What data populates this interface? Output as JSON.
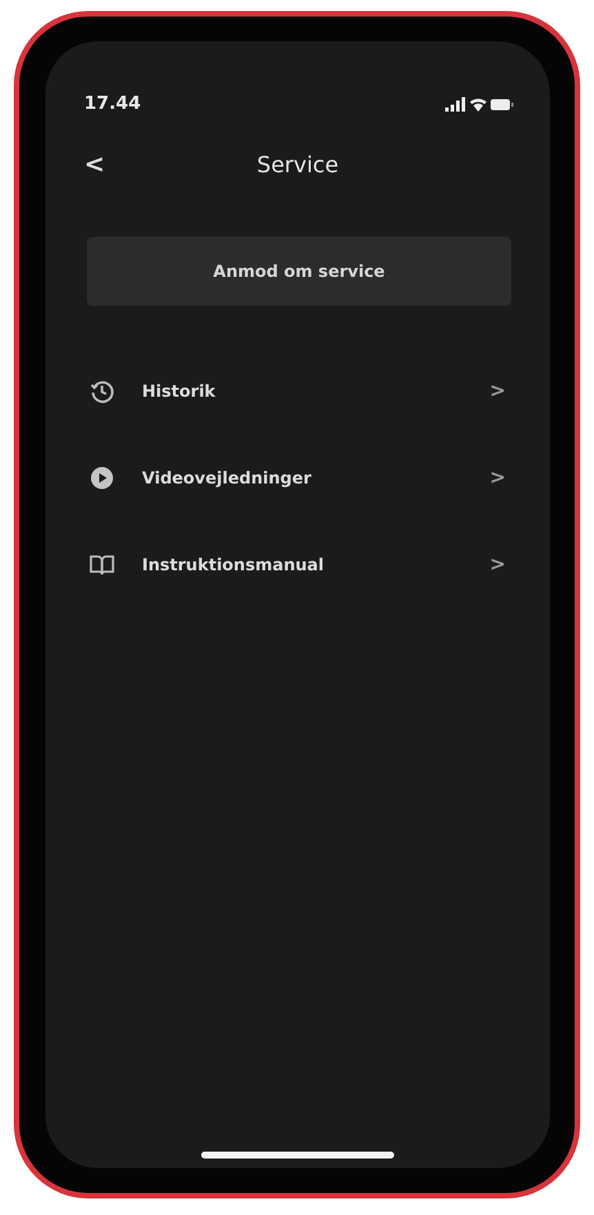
{
  "status_bar": {
    "time": "17.44"
  },
  "header": {
    "back": "<",
    "title": "Service"
  },
  "primary_button": {
    "label": "Anmod om service"
  },
  "menu_items": [
    {
      "kind": "history",
      "label": "Historik",
      "chevron": ">"
    },
    {
      "kind": "video",
      "label": "Videovejledninger",
      "chevron": ">"
    },
    {
      "kind": "manual",
      "label": "Instruktionsmanual",
      "chevron": ">"
    }
  ]
}
